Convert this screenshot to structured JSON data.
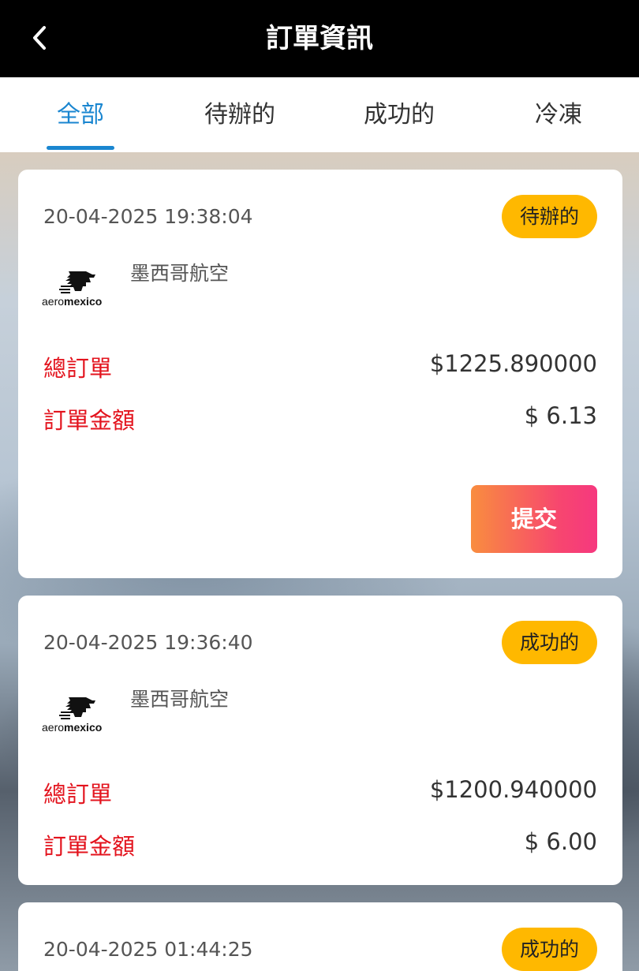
{
  "header": {
    "title": "訂單資訊",
    "back_icon": "chevron-left-icon"
  },
  "tabs": [
    {
      "label": "全部",
      "active": true
    },
    {
      "label": "待辦的",
      "active": false
    },
    {
      "label": "成功的",
      "active": false
    },
    {
      "label": "冷凍",
      "active": false
    }
  ],
  "colors": {
    "accent": "#1a86d0",
    "badge": "#ffb800",
    "label_red": "#e3131d"
  },
  "orders": [
    {
      "datetime": "20-04-2025 19:38:04",
      "status": "待辦的",
      "airline": "墨西哥航空",
      "logo_text": "aeromexico",
      "total_label": "總訂單",
      "total_value": "$1225.890000",
      "amount_label": "訂單金額",
      "amount_value": "$ 6.13",
      "submit_label": "提交"
    },
    {
      "datetime": "20-04-2025 19:36:40",
      "status": "成功的",
      "airline": "墨西哥航空",
      "logo_text": "aeromexico",
      "total_label": "總訂單",
      "total_value": "$1200.940000",
      "amount_label": "訂單金額",
      "amount_value": "$ 6.00"
    },
    {
      "datetime": "20-04-2025 01:44:25",
      "status": "成功的"
    }
  ]
}
